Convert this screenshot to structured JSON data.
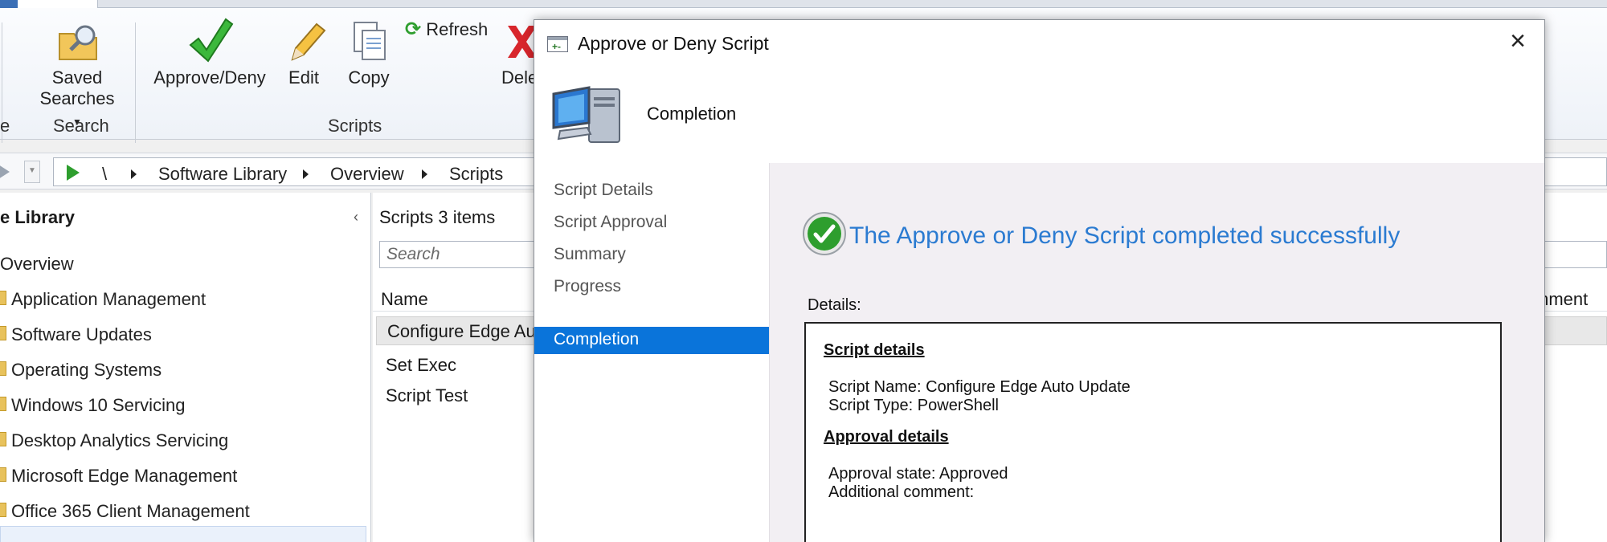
{
  "ribbon": {
    "saved_searches_label": "Saved",
    "saved_searches_label2": "Searches",
    "approve_deny_label": "Approve/Deny",
    "edit_label": "Edit",
    "copy_label": "Copy",
    "refresh_label": "Refresh",
    "delete_label": "Dele",
    "search_group_label": "Search",
    "scripts_group_label": "Scripts",
    "left_group_fragment": "e"
  },
  "breadcrumb": {
    "root": "\\",
    "items": [
      "Software Library",
      "Overview",
      "Scripts"
    ]
  },
  "nav": {
    "title": "e Library",
    "overview": "Overview",
    "items": [
      "Application Management",
      "Software Updates",
      "Operating Systems",
      "Windows 10 Servicing",
      "Desktop Analytics Servicing",
      "Microsoft Edge Management",
      "Office 365 Client Management"
    ]
  },
  "list": {
    "header": "Scripts 3 items",
    "search_placeholder": "Search",
    "column_name": "Name",
    "column_comment": "mment",
    "rows": [
      "Configure Edge Au",
      "Set Exec",
      "Script Test"
    ]
  },
  "dialog": {
    "title": "Approve or Deny Script",
    "header_title": "Completion",
    "steps": [
      "Script Details",
      "Script Approval",
      "Summary",
      "Progress",
      "Completion"
    ],
    "active_step": "Completion",
    "success_message": "The Approve or Deny Script completed successfully",
    "details_label": "Details:",
    "script_details_heading": "Script details",
    "script_name_line": "Script Name: Configure Edge Auto Update",
    "script_type_line": "Script Type: PowerShell",
    "approval_details_heading": "Approval details",
    "approval_state_line": "Approval state: Approved",
    "additional_comment_line": "Additional comment:"
  },
  "colors": {
    "accent": "#0a74da",
    "success_text": "#2b7bd1",
    "success_green": "#2e9e2e"
  }
}
